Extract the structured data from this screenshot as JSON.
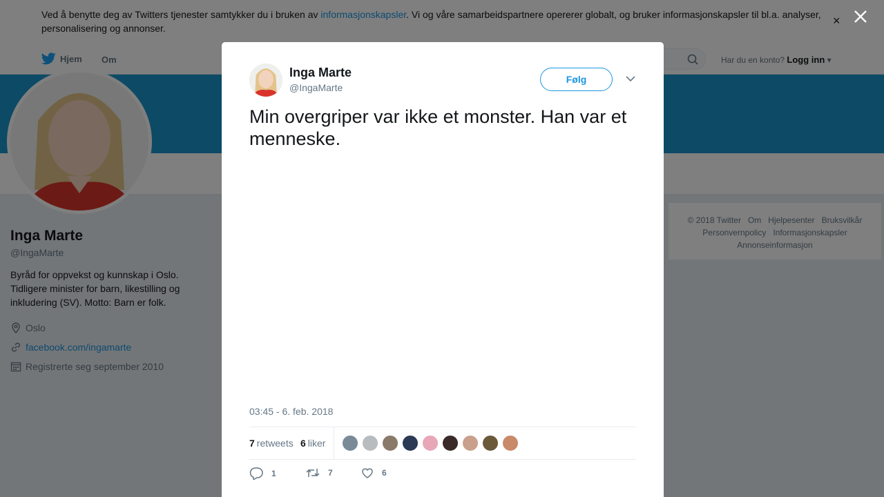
{
  "cookie": {
    "text_before": "Ved å benytte deg av Twitters tjenester samtykker du i bruken av ",
    "link": "informasjonskapsler",
    "text_after": ". Vi og våre samarbeidspartnere opererer globalt, og bruker informasjonskapsler til bl.a. analyser, personalisering og annonser.",
    "close_glyph": "×"
  },
  "nav": {
    "home": "Hjem",
    "about": "Om",
    "login_prompt": "Har du en konto?",
    "login": "Logg inn"
  },
  "profile": {
    "name": "Inga Marte",
    "handle": "@IngaMarte",
    "bio": "Byråd for oppvekst og kunnskap i Oslo. Tidligere minister for barn, likestilling og inkludering (SV). Motto: Barn er folk.",
    "location": "Oslo",
    "website": "facebook.com/ingamarte",
    "joined": "Registrerte seg september 2010"
  },
  "footer": {
    "links": [
      "© 2018 Twitter",
      "Om",
      "Hjelpesenter",
      "Bruksvilkår",
      "Personvernpolicy",
      "Informasjonskapsler",
      "Annonseinformasjon"
    ]
  },
  "tweet": {
    "name": "Inga Marte",
    "handle": "@IngaMarte",
    "follow": "Følg",
    "text": "Min overgriper var ikke et monster. Han var et menneske.",
    "timestamp": "03:45 - 6. feb. 2018",
    "retweets_count": "7",
    "retweets_label": "retweets",
    "likes_count": "6",
    "likes_label": "liker",
    "reply_count": "1",
    "retweet_count": "7",
    "like_count": "6"
  },
  "colors": {
    "accent": "#1b95e0",
    "banner": "#1b95cc"
  },
  "faces": [
    "#7a8a96",
    "#b8bcbf",
    "#8a7a6a",
    "#2b3a55",
    "#e7a7b8",
    "#3a2a2a",
    "#c9a08c",
    "#6b5a3a",
    "#c98a6a"
  ]
}
